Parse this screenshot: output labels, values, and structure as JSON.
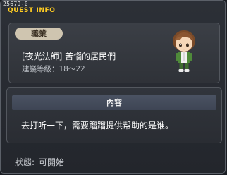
{
  "window": {
    "quest_id": "25679-0",
    "title": "QUEST INFO"
  },
  "job": {
    "label": "職業"
  },
  "quest": {
    "name": "[夜光法師] 苦惱的居民們",
    "recommended_level": "建議等級：18～22"
  },
  "content": {
    "header": "內容",
    "text": "去打听一下，需要蹓蹓提供帮助的是谁。"
  },
  "status": {
    "label": "狀態:",
    "value": "可開始"
  },
  "colors": {
    "title": "#ffcc22",
    "badge": "#cfc5b0",
    "header_bar": "#4a5262"
  }
}
